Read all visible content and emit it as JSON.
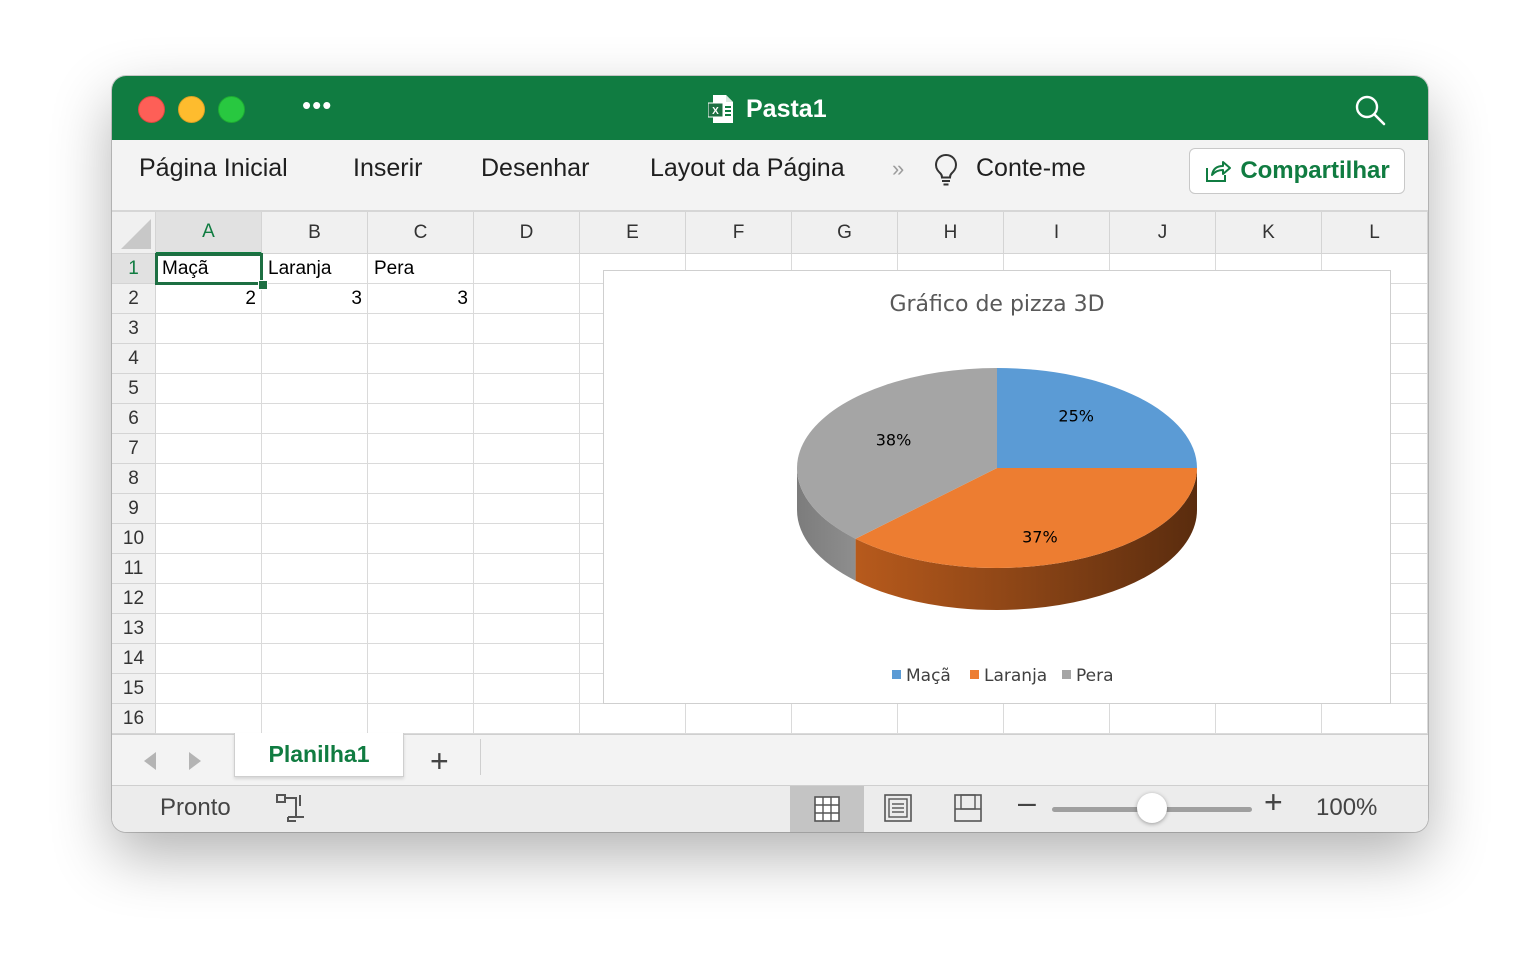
{
  "window": {
    "title": "Pasta1"
  },
  "ribbon": {
    "tabs": [
      "Página Inicial",
      "Inserir",
      "Desenhar",
      "Layout da Página"
    ],
    "overflow": "»",
    "tell_me": "Conte-me",
    "share_label": "Compartilhar"
  },
  "sheet": {
    "columns": [
      "A",
      "B",
      "C",
      "D",
      "E",
      "F",
      "G",
      "H",
      "I",
      "J",
      "K",
      "L"
    ],
    "rows": [
      "1",
      "2",
      "3",
      "4",
      "5",
      "6",
      "7",
      "8",
      "9",
      "10",
      "11",
      "12",
      "13",
      "14",
      "15",
      "16"
    ],
    "cells": {
      "A1": "Maçã",
      "B1": "Laranja",
      "C1": "Pera",
      "A2": "2",
      "B2": "3",
      "C2": "3"
    },
    "selected_cell": "A1"
  },
  "chart_data": {
    "type": "pie",
    "title": "Gráfico de pizza 3D",
    "categories": [
      "Maçã",
      "Laranja",
      "Pera"
    ],
    "values": [
      2,
      3,
      3
    ],
    "data_labels": [
      "25%",
      "37%",
      "38%"
    ],
    "colors": [
      "#5b9bd5",
      "#ed7d31",
      "#a5a5a5"
    ],
    "legend_position": "bottom",
    "three_d": true
  },
  "sheetbar": {
    "active_sheet": "Planilha1",
    "add_label": "+"
  },
  "statusbar": {
    "status": "Pronto",
    "zoom_minus": "–",
    "zoom_plus": "+",
    "zoom_level": "100%",
    "zoom_value": 100
  },
  "colors": {
    "brand": "#107c41"
  }
}
